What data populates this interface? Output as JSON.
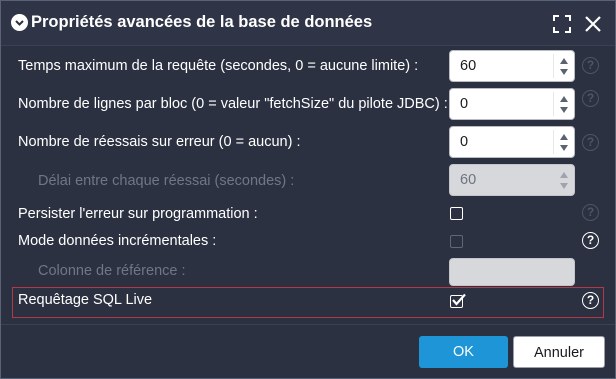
{
  "dialog": {
    "title": "Propriétés avancées de la base de données"
  },
  "fields": {
    "max_query_time": {
      "label": "Temps maximum de la requête (secondes, 0 = aucune limite) :",
      "value": "60"
    },
    "rows_per_block": {
      "label": "Nombre de lignes par bloc (0 = valeur \"fetchSize\" du pilote JDBC) :",
      "value": "0"
    },
    "retries_on_error": {
      "label": "Nombre de réessais sur erreur (0 = aucun) :",
      "value": "0"
    },
    "retry_delay": {
      "label": "Délai entre chaque réessai (secondes) :",
      "value": "60",
      "disabled": true
    },
    "persist_error": {
      "label": "Persister l'erreur sur programmation :",
      "checked": false
    },
    "incremental_mode": {
      "label": "Mode données incrémentales :",
      "checked": false,
      "disabled": true
    },
    "reference_column": {
      "label": "Colonne de référence :",
      "value": "",
      "disabled": true
    },
    "live_sql": {
      "label": "Requêtage SQL Live",
      "checked": true
    }
  },
  "help_icon_text": "?",
  "buttons": {
    "ok": "OK",
    "cancel": "Annuler"
  },
  "colors": {
    "dialog_bg": "#2b3141",
    "primary": "#1d95d6",
    "highlight_border": "#b23a48"
  }
}
